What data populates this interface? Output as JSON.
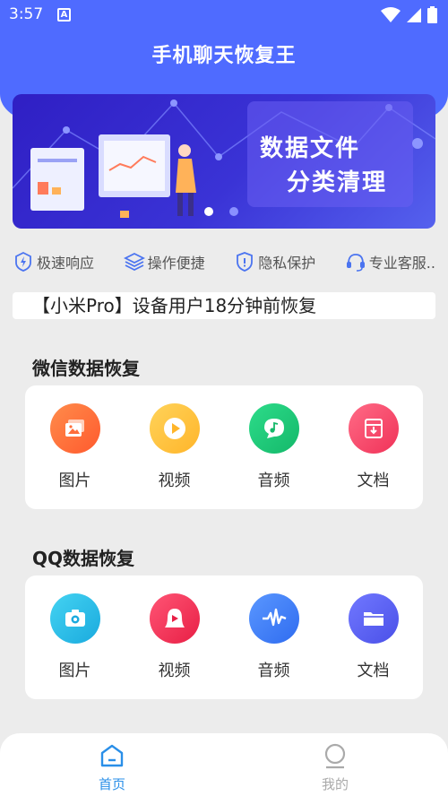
{
  "status_bar": {
    "time": "3:57",
    "notif_glyph": "A"
  },
  "header": {
    "title": "手机聊天恢复王"
  },
  "banner": {
    "line1": "数据文件",
    "line2": "分类清理"
  },
  "features": [
    {
      "label": "极速响应",
      "icon": "lightning-icon"
    },
    {
      "label": "操作便捷",
      "icon": "layers-icon"
    },
    {
      "label": "隐私保护",
      "icon": "shield-icon"
    },
    {
      "label": "专业客服..",
      "icon": "headset-icon"
    }
  ],
  "ticker": {
    "text": "【小米Pro】设备用户18分钟前恢复"
  },
  "wechat": {
    "title": "微信数据恢复",
    "items": [
      {
        "label": "图片",
        "icon": "image-icon",
        "color": "#ff6d3a"
      },
      {
        "label": "视频",
        "icon": "play-icon",
        "color": "#ffc43d"
      },
      {
        "label": "音频",
        "icon": "music-note-icon",
        "color": "#1fcc7a"
      },
      {
        "label": "文档",
        "icon": "document-icon",
        "color": "#ff4a6a"
      }
    ]
  },
  "qq": {
    "title": "QQ数据恢复",
    "items": [
      {
        "label": "图片",
        "icon": "camera-icon",
        "color": "#28bfe9"
      },
      {
        "label": "视频",
        "icon": "video-icon",
        "color": "#f5385a"
      },
      {
        "label": "音频",
        "icon": "waveform-icon",
        "color": "#3d7ff7"
      },
      {
        "label": "文档",
        "icon": "folder-icon",
        "color": "#5b63f2"
      }
    ]
  },
  "tabbar": {
    "home_label": "首页",
    "mine_label": "我的",
    "active_color": "#2a8fe8",
    "inactive_color": "#aaaaaa"
  }
}
